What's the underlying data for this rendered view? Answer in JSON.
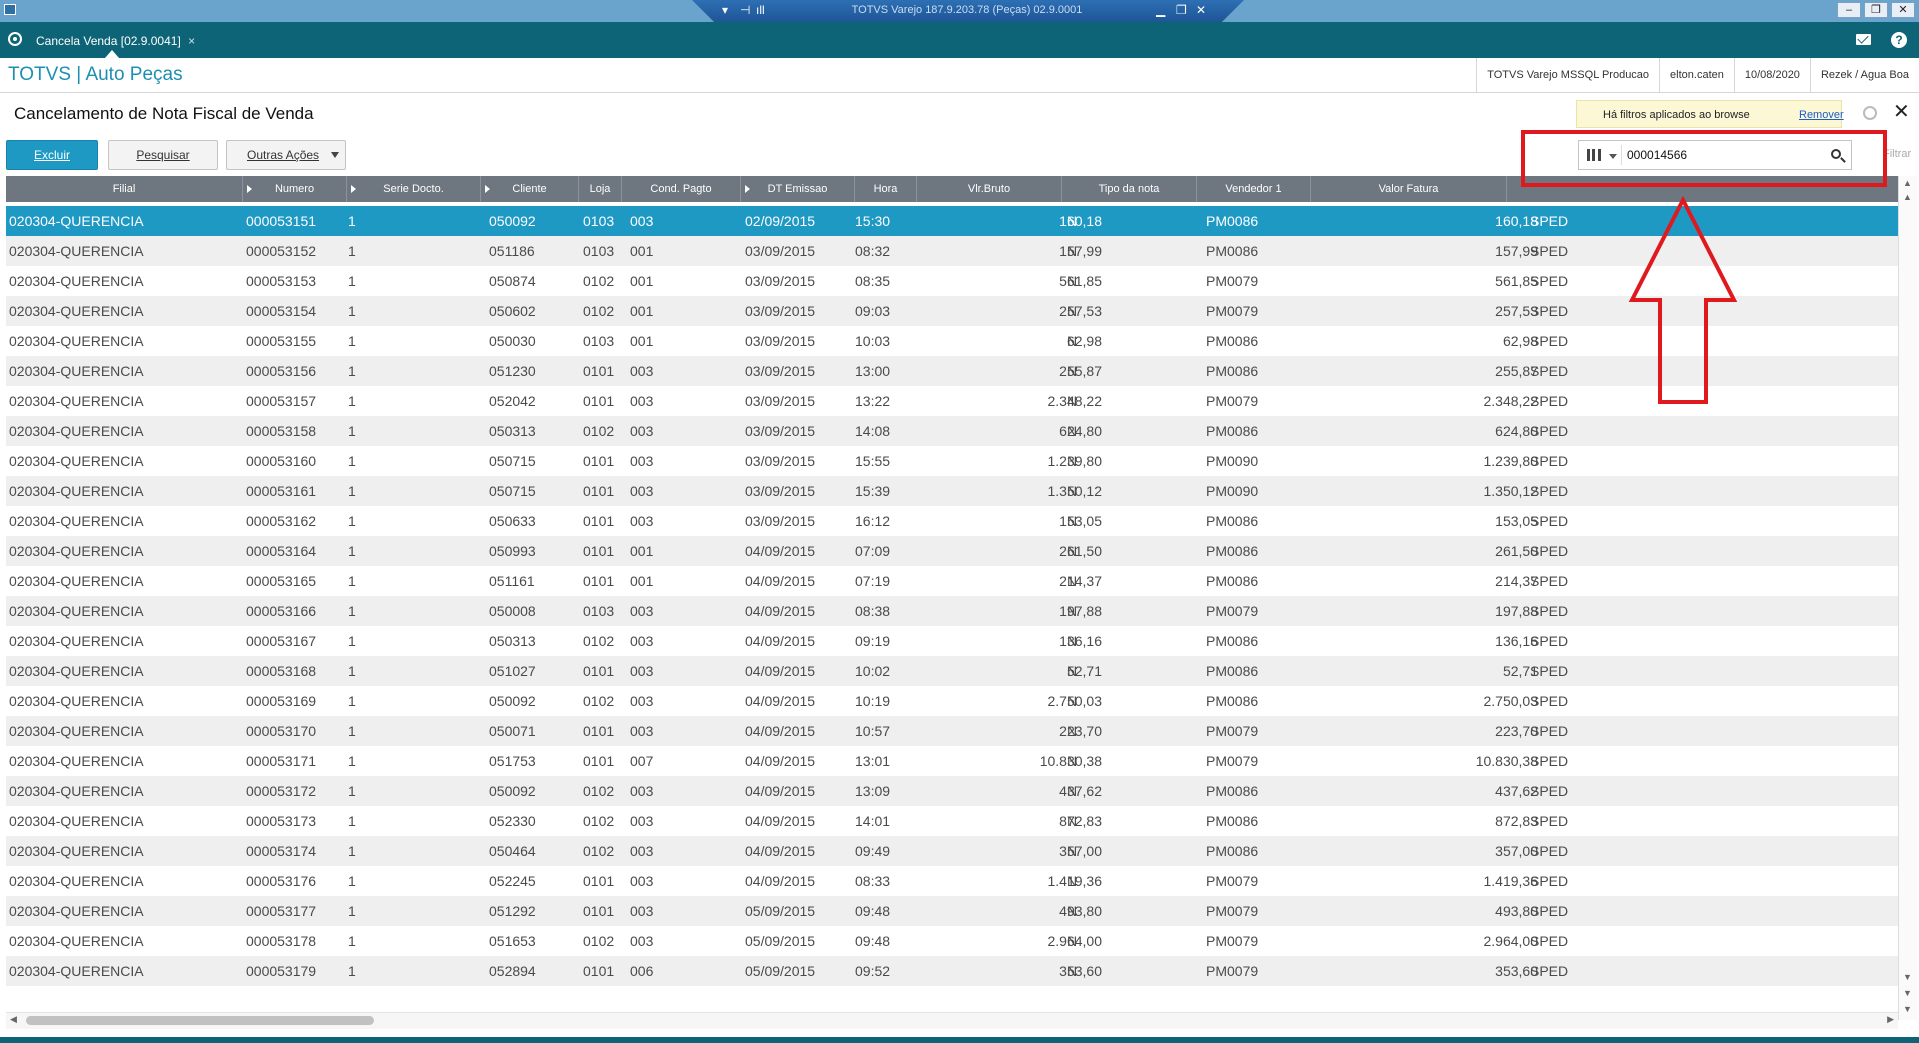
{
  "remote": {
    "title": "TOTVS Varejo 187.9.203.78 (Peças) 02.9.0001"
  },
  "tab": {
    "label": "Cancela Venda [02.9.0041]",
    "close": "×"
  },
  "brand": {
    "title": "TOTVS | Auto Peças",
    "environment": "TOTVS Varejo MSSQL Producao",
    "user": "elton.caten",
    "date": "10/08/2020",
    "branch": "Rezek / Agua Boa"
  },
  "page": {
    "title": "Cancelamento de Nota Fiscal de Venda"
  },
  "filter_notice": {
    "text": "Há filtros aplicados ao browse",
    "remove_label": "Remover"
  },
  "toolbar": {
    "excluir": "Excluir",
    "pesquisar": "Pesquisar",
    "outras": "Outras Ações"
  },
  "search": {
    "value": "000014566",
    "filtrar_label": "Filtrar"
  },
  "grid": {
    "columns": [
      "Filial",
      "Numero",
      "Serie Docto.",
      "Cliente",
      "Loja",
      "Cond. Pagto",
      "DT Emissao",
      "Hora",
      "Vlr.Bruto",
      "Tipo da nota",
      "Vendedor 1",
      "Valor Fatura"
    ],
    "rows": [
      {
        "filial": "020304-QUERENCIA",
        "numero": "000053151",
        "serie": "1",
        "cliente": "050092",
        "loja": "0103",
        "cond": "003",
        "dt": "02/09/2015",
        "hora": "15:30",
        "bruto": "160,18",
        "tipo": "N",
        "vend": "PM0086",
        "fatura": "160,18",
        "esp": "SPED"
      },
      {
        "filial": "020304-QUERENCIA",
        "numero": "000053152",
        "serie": "1",
        "cliente": "051186",
        "loja": "0103",
        "cond": "001",
        "dt": "03/09/2015",
        "hora": "08:32",
        "bruto": "157,99",
        "tipo": "N",
        "vend": "PM0086",
        "fatura": "157,99",
        "esp": "SPED"
      },
      {
        "filial": "020304-QUERENCIA",
        "numero": "000053153",
        "serie": "1",
        "cliente": "050874",
        "loja": "0102",
        "cond": "001",
        "dt": "03/09/2015",
        "hora": "08:35",
        "bruto": "561,85",
        "tipo": "N",
        "vend": "PM0079",
        "fatura": "561,85",
        "esp": "SPED"
      },
      {
        "filial": "020304-QUERENCIA",
        "numero": "000053154",
        "serie": "1",
        "cliente": "050602",
        "loja": "0102",
        "cond": "001",
        "dt": "03/09/2015",
        "hora": "09:03",
        "bruto": "257,53",
        "tipo": "N",
        "vend": "PM0079",
        "fatura": "257,53",
        "esp": "SPED"
      },
      {
        "filial": "020304-QUERENCIA",
        "numero": "000053155",
        "serie": "1",
        "cliente": "050030",
        "loja": "0103",
        "cond": "001",
        "dt": "03/09/2015",
        "hora": "10:03",
        "bruto": "62,98",
        "tipo": "N",
        "vend": "PM0086",
        "fatura": "62,98",
        "esp": "SPED"
      },
      {
        "filial": "020304-QUERENCIA",
        "numero": "000053156",
        "serie": "1",
        "cliente": "051230",
        "loja": "0101",
        "cond": "003",
        "dt": "03/09/2015",
        "hora": "13:00",
        "bruto": "255,87",
        "tipo": "N",
        "vend": "PM0086",
        "fatura": "255,87",
        "esp": "SPED"
      },
      {
        "filial": "020304-QUERENCIA",
        "numero": "000053157",
        "serie": "1",
        "cliente": "052042",
        "loja": "0101",
        "cond": "003",
        "dt": "03/09/2015",
        "hora": "13:22",
        "bruto": "2.348,22",
        "tipo": "N",
        "vend": "PM0079",
        "fatura": "2.348,22",
        "esp": "SPED"
      },
      {
        "filial": "020304-QUERENCIA",
        "numero": "000053158",
        "serie": "1",
        "cliente": "050313",
        "loja": "0102",
        "cond": "003",
        "dt": "03/09/2015",
        "hora": "14:08",
        "bruto": "624,80",
        "tipo": "N",
        "vend": "PM0086",
        "fatura": "624,80",
        "esp": "SPED"
      },
      {
        "filial": "020304-QUERENCIA",
        "numero": "000053160",
        "serie": "1",
        "cliente": "050715",
        "loja": "0101",
        "cond": "003",
        "dt": "03/09/2015",
        "hora": "15:55",
        "bruto": "1.239,80",
        "tipo": "N",
        "vend": "PM0090",
        "fatura": "1.239,80",
        "esp": "SPED"
      },
      {
        "filial": "020304-QUERENCIA",
        "numero": "000053161",
        "serie": "1",
        "cliente": "050715",
        "loja": "0101",
        "cond": "003",
        "dt": "03/09/2015",
        "hora": "15:39",
        "bruto": "1.350,12",
        "tipo": "N",
        "vend": "PM0090",
        "fatura": "1.350,12",
        "esp": "SPED"
      },
      {
        "filial": "020304-QUERENCIA",
        "numero": "000053162",
        "serie": "1",
        "cliente": "050633",
        "loja": "0101",
        "cond": "003",
        "dt": "03/09/2015",
        "hora": "16:12",
        "bruto": "153,05",
        "tipo": "N",
        "vend": "PM0086",
        "fatura": "153,05",
        "esp": "SPED"
      },
      {
        "filial": "020304-QUERENCIA",
        "numero": "000053164",
        "serie": "1",
        "cliente": "050993",
        "loja": "0101",
        "cond": "001",
        "dt": "04/09/2015",
        "hora": "07:09",
        "bruto": "261,50",
        "tipo": "N",
        "vend": "PM0086",
        "fatura": "261,50",
        "esp": "SPED"
      },
      {
        "filial": "020304-QUERENCIA",
        "numero": "000053165",
        "serie": "1",
        "cliente": "051161",
        "loja": "0101",
        "cond": "001",
        "dt": "04/09/2015",
        "hora": "07:19",
        "bruto": "214,37",
        "tipo": "N",
        "vend": "PM0086",
        "fatura": "214,37",
        "esp": "SPED"
      },
      {
        "filial": "020304-QUERENCIA",
        "numero": "000053166",
        "serie": "1",
        "cliente": "050008",
        "loja": "0103",
        "cond": "003",
        "dt": "04/09/2015",
        "hora": "08:38",
        "bruto": "197,88",
        "tipo": "N",
        "vend": "PM0079",
        "fatura": "197,88",
        "esp": "SPED"
      },
      {
        "filial": "020304-QUERENCIA",
        "numero": "000053167",
        "serie": "1",
        "cliente": "050313",
        "loja": "0102",
        "cond": "003",
        "dt": "04/09/2015",
        "hora": "09:19",
        "bruto": "136,16",
        "tipo": "N",
        "vend": "PM0086",
        "fatura": "136,16",
        "esp": "SPED"
      },
      {
        "filial": "020304-QUERENCIA",
        "numero": "000053168",
        "serie": "1",
        "cliente": "051027",
        "loja": "0101",
        "cond": "003",
        "dt": "04/09/2015",
        "hora": "10:02",
        "bruto": "52,71",
        "tipo": "N",
        "vend": "PM0086",
        "fatura": "52,71",
        "esp": "SPED"
      },
      {
        "filial": "020304-QUERENCIA",
        "numero": "000053169",
        "serie": "1",
        "cliente": "050092",
        "loja": "0102",
        "cond": "003",
        "dt": "04/09/2015",
        "hora": "10:19",
        "bruto": "2.750,03",
        "tipo": "N",
        "vend": "PM0086",
        "fatura": "2.750,03",
        "esp": "SPED"
      },
      {
        "filial": "020304-QUERENCIA",
        "numero": "000053170",
        "serie": "1",
        "cliente": "050071",
        "loja": "0101",
        "cond": "003",
        "dt": "04/09/2015",
        "hora": "10:57",
        "bruto": "223,70",
        "tipo": "N",
        "vend": "PM0079",
        "fatura": "223,70",
        "esp": "SPED"
      },
      {
        "filial": "020304-QUERENCIA",
        "numero": "000053171",
        "serie": "1",
        "cliente": "051753",
        "loja": "0101",
        "cond": "007",
        "dt": "04/09/2015",
        "hora": "13:01",
        "bruto": "10.830,38",
        "tipo": "N",
        "vend": "PM0079",
        "fatura": "10.830,38",
        "esp": "SPED"
      },
      {
        "filial": "020304-QUERENCIA",
        "numero": "000053172",
        "serie": "1",
        "cliente": "050092",
        "loja": "0102",
        "cond": "003",
        "dt": "04/09/2015",
        "hora": "13:09",
        "bruto": "437,62",
        "tipo": "N",
        "vend": "PM0086",
        "fatura": "437,62",
        "esp": "SPED"
      },
      {
        "filial": "020304-QUERENCIA",
        "numero": "000053173",
        "serie": "1",
        "cliente": "052330",
        "loja": "0102",
        "cond": "003",
        "dt": "04/09/2015",
        "hora": "14:01",
        "bruto": "872,83",
        "tipo": "N",
        "vend": "PM0086",
        "fatura": "872,83",
        "esp": "SPED"
      },
      {
        "filial": "020304-QUERENCIA",
        "numero": "000053174",
        "serie": "1",
        "cliente": "050464",
        "loja": "0102",
        "cond": "003",
        "dt": "04/09/2015",
        "hora": "09:49",
        "bruto": "357,00",
        "tipo": "N",
        "vend": "PM0086",
        "fatura": "357,00",
        "esp": "SPED"
      },
      {
        "filial": "020304-QUERENCIA",
        "numero": "000053176",
        "serie": "1",
        "cliente": "052245",
        "loja": "0101",
        "cond": "003",
        "dt": "04/09/2015",
        "hora": "08:33",
        "bruto": "1.419,36",
        "tipo": "N",
        "vend": "PM0079",
        "fatura": "1.419,36",
        "esp": "SPED"
      },
      {
        "filial": "020304-QUERENCIA",
        "numero": "000053177",
        "serie": "1",
        "cliente": "051292",
        "loja": "0101",
        "cond": "003",
        "dt": "05/09/2015",
        "hora": "09:48",
        "bruto": "493,80",
        "tipo": "N",
        "vend": "PM0079",
        "fatura": "493,80",
        "esp": "SPED"
      },
      {
        "filial": "020304-QUERENCIA",
        "numero": "000053178",
        "serie": "1",
        "cliente": "051653",
        "loja": "0102",
        "cond": "003",
        "dt": "05/09/2015",
        "hora": "09:48",
        "bruto": "2.964,00",
        "tipo": "N",
        "vend": "PM0079",
        "fatura": "2.964,00",
        "esp": "SPED"
      },
      {
        "filial": "020304-QUERENCIA",
        "numero": "000053179",
        "serie": "1",
        "cliente": "052894",
        "loja": "0101",
        "cond": "006",
        "dt": "05/09/2015",
        "hora": "09:52",
        "bruto": "353,60",
        "tipo": "N",
        "vend": "PM0079",
        "fatura": "353,60",
        "esp": "SPED"
      }
    ]
  },
  "colors": {
    "accent": "#1d99c4",
    "tabbar": "#0e6477",
    "annotation": "#e0191f"
  }
}
